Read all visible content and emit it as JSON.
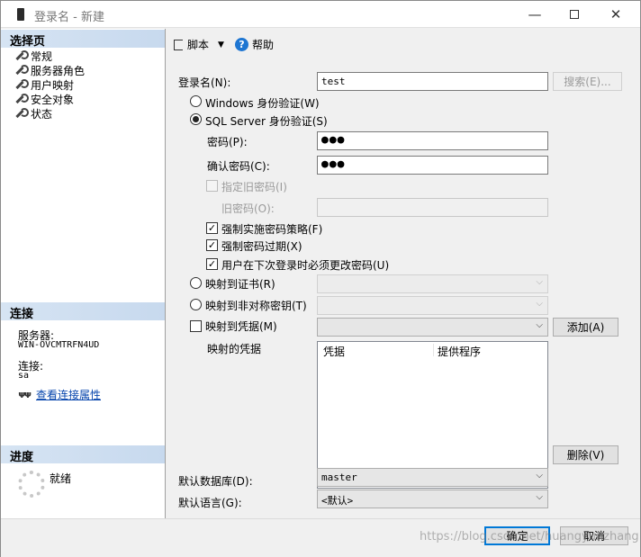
{
  "window": {
    "title": "登录名 - 新建"
  },
  "left": {
    "select_page_header": "选择页",
    "pages": [
      "常规",
      "服务器角色",
      "用户映射",
      "安全对象",
      "状态"
    ],
    "connection_header": "连接",
    "server_label": "服务器:",
    "server_value": "WIN-OVCMTRFN4UD",
    "connection_label": "连接:",
    "connection_value": "sa",
    "view_props_link": "查看连接属性",
    "progress_header": "进度",
    "progress_status": "就绪"
  },
  "toolbar": {
    "script_label": "脚本",
    "help_label": "帮助"
  },
  "form": {
    "login_name_label": "登录名(N):",
    "login_name_value": "test",
    "search_button": "搜索(E)...",
    "windows_auth_label": "Windows 身份验证(W)",
    "sql_auth_label": "SQL Server 身份验证(S)",
    "auth_selected": "sql",
    "password_label": "密码(P):",
    "password_value": "●●●",
    "confirm_password_label": "确认密码(C):",
    "confirm_password_value": "●●●",
    "specify_old_password_label": "指定旧密码(I)",
    "old_password_label": "旧密码(O):",
    "enforce_policy_label": "强制实施密码策略(F)",
    "enforce_policy_checked": true,
    "enforce_expiration_label": "强制密码过期(X)",
    "enforce_expiration_checked": true,
    "must_change_label": "用户在下次登录时必须更改密码(U)",
    "must_change_checked": true,
    "map_cert_label": "映射到证书(R)",
    "map_asym_key_label": "映射到非对称密钥(T)",
    "map_credential_label": "映射到凭据(M)",
    "add_button": "添加(A)",
    "mapped_credentials_label": "映射的凭据",
    "credentials_columns": [
      "凭据",
      "提供程序"
    ],
    "remove_button": "删除(V)",
    "default_db_label": "默认数据库(D):",
    "default_db_value": "master",
    "default_lang_label": "默认语言(G):",
    "default_lang_value": "<默认>"
  },
  "footer": {
    "ok_button": "确定",
    "cancel_button": "取消"
  },
  "watermark": "https://blog.csdn.net/huangyunzhang"
}
